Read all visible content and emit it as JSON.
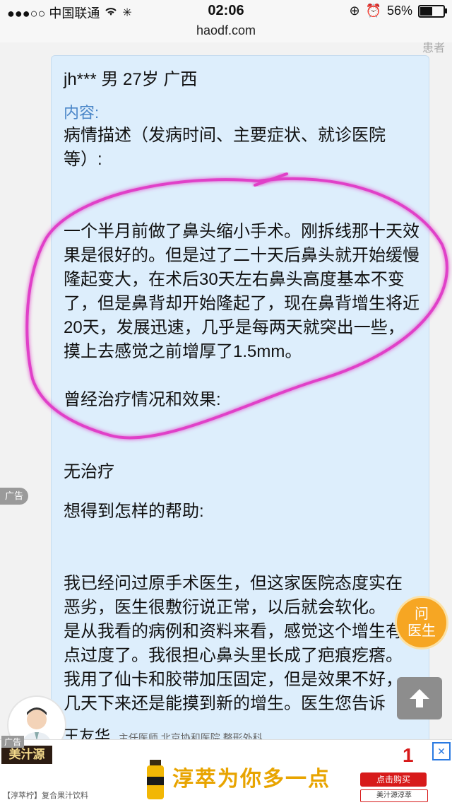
{
  "status_bar": {
    "carrier": "●●●○○ 中国联通",
    "time": "02:06",
    "battery_percent_label": "56%",
    "battery_level": 0.56
  },
  "url_bar": {
    "domain": "haodf.com"
  },
  "top_fragment": "患者",
  "post": {
    "author_line": "jh*** 男 27岁 广西",
    "content_label": "内容:",
    "sections": {
      "q1": "病情描述（发病时间、主要症状、就诊医院等）:",
      "a1": "一个半月前做了鼻头缩小手术。刚拆线那十天效果是很好的。但是过了二十天后鼻头就开始缓慢隆起变大，在术后30天左右鼻头高度基本不变了，但是鼻背却开始隆起了，现在鼻背增生将近20天，发展迅速，几乎是每两天就突出一些，摸上去感觉之前增厚了1.5mm。",
      "q2": "曾经治疗情况和效果:",
      "a2": "无治疗",
      "q3": "想得到怎样的帮助:",
      "a3_l1": "我已经问过原手术医生，但这家医院态度实在",
      "a3_l2": "恶劣，医生很敷衍说正常，以后就会软化。",
      "a3_l3": "是从我看的病例和资料来看，感觉这个增生有",
      "a3_l4": "点过度了。我很担心鼻头里长成了疤痕疙瘩。",
      "a3_l5": "我用了仙卡和胶带加压固定，但是效果不好，",
      "a3_l6": "几天下来还是能摸到新的增生。医生您告诉"
    }
  },
  "side_ad_tag": "广告",
  "ask_doctor": {
    "line1": "问",
    "line2": "医生"
  },
  "bottom_strip": {
    "text_big": "王友华",
    "text_small": "主任医师 北京协和医院 整形外科"
  },
  "ad_banner": {
    "tag": "广告",
    "brand": "美汁源",
    "slogan": "淳萃为你多一点",
    "number_badge": "1",
    "buy_label": "点击购买",
    "store_label": "美汁源淳萃",
    "small_text": "【淳萃柠】复合果汁饮料",
    "close_label": "✕"
  },
  "colors": {
    "bubble_bg": "#ddeefc",
    "label_blue": "#4a86c8",
    "highlight_pink": "#e040c8",
    "ask_doctor_orange": "#f6a623",
    "ad_red": "#d71a1a"
  }
}
